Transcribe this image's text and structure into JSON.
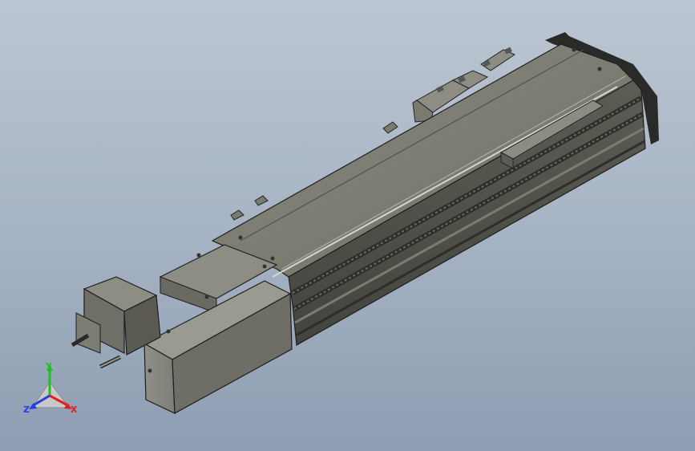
{
  "viewport": {
    "background_top": "#bcc6d2",
    "background_bottom": "#8e9db2",
    "model_color": "#7a7a70"
  },
  "triad": {
    "x_label": "X",
    "y_label": "Y",
    "z_label": "Z",
    "x_color": "#e02020",
    "y_color": "#20c020",
    "z_color": "#2040e0"
  }
}
